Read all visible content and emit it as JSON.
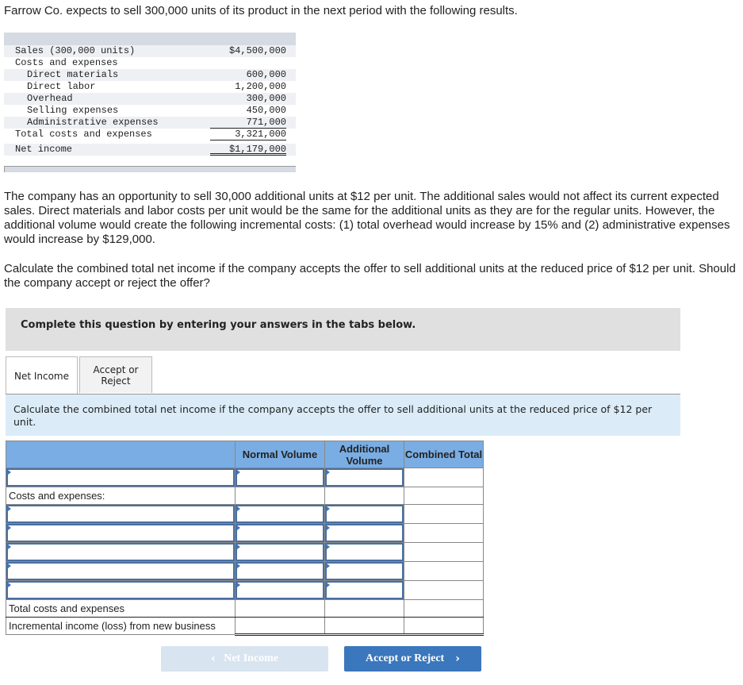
{
  "intro": "Farrow Co. expects to sell 300,000 units of its product in the next period with the following results.",
  "statement": {
    "rows": [
      {
        "label": "Sales (300,000 units)",
        "value": "$4,500,000",
        "indent": false
      },
      {
        "label": "Costs and expenses",
        "value": "",
        "indent": false
      },
      {
        "label": "Direct materials",
        "value": "600,000",
        "indent": true
      },
      {
        "label": "Direct labor",
        "value": "1,200,000",
        "indent": true
      },
      {
        "label": "Overhead",
        "value": "300,000",
        "indent": true
      },
      {
        "label": "Selling expenses",
        "value": "450,000",
        "indent": true
      },
      {
        "label": "Administrative expenses",
        "value": "771,000",
        "indent": true
      },
      {
        "label": "Total costs and expenses",
        "value": "3,321,000",
        "indent": false
      },
      {
        "label": "Net income",
        "value": "$1,179,000",
        "indent": false
      }
    ]
  },
  "paragraph1": "The company has an opportunity to sell 30,000 additional units at $12 per unit. The additional sales would not affect its current expected sales. Direct materials and labor costs per unit would be the same for the additional units as they are for the regular units. However, the additional volume would create the following incremental costs: (1) total overhead would increase by 15% and (2) administrative expenses would increase by $129,000.",
  "paragraph2": "Calculate the combined total net income if the company accepts the offer to sell additional units at the reduced price of $12 per unit. Should the company accept or reject the offer?",
  "banner": "Complete this question by entering your answers in the tabs below.",
  "tabs": [
    {
      "label": "Net Income",
      "active": true
    },
    {
      "label": "Accept or Reject",
      "active": false
    }
  ],
  "instruction": "Calculate the combined total net income if the company accepts the offer to sell additional units at the reduced price of $12 per unit.",
  "table": {
    "headers": [
      "",
      "Normal Volume",
      "Additional Volume",
      "Combined Total"
    ],
    "costs_label": "Costs and expenses:",
    "total_label": "Total costs and expenses",
    "net_label": "Incremental income (loss) from new business"
  },
  "nav": {
    "prev_label": "Net Income",
    "next_label": "Accept or Reject"
  }
}
